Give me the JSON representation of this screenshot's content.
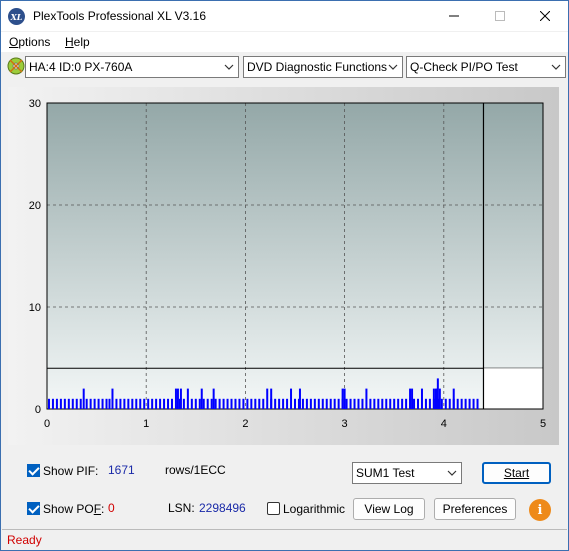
{
  "window": {
    "title": "PlexTools Professional XL V3.16",
    "app_icon_text": "XL"
  },
  "menu": {
    "items": [
      {
        "label": "Options",
        "accel": "O",
        "rest": "ptions"
      },
      {
        "label": "Help",
        "accel": "H",
        "rest": "elp"
      }
    ]
  },
  "toolbar": {
    "drive": "HA:4 ID:0  PX-760A",
    "function": "DVD Diagnostic Functions",
    "test": "Q-Check PI/PO Test"
  },
  "chart_data": {
    "type": "bar",
    "x_ticks": [
      "0",
      "1",
      "2",
      "3",
      "4",
      "5"
    ],
    "y_ticks": [
      "0",
      "10",
      "20",
      "30"
    ],
    "xlim": [
      0,
      5
    ],
    "ylim": [
      0,
      30
    ],
    "grid": true,
    "threshold": 4,
    "marker_x": 4.4,
    "series": [
      {
        "color": "#0000ff",
        "x": [
          0.02,
          0.06,
          0.1,
          0.14,
          0.18,
          0.22,
          0.26,
          0.3,
          0.34,
          0.37,
          0.4,
          0.44,
          0.48,
          0.52,
          0.56,
          0.6,
          0.63,
          0.66,
          0.7,
          0.74,
          0.78,
          0.82,
          0.86,
          0.9,
          0.94,
          0.98,
          1.02,
          1.06,
          1.1,
          1.14,
          1.18,
          1.22,
          1.26,
          1.3,
          1.34,
          1.38,
          1.42,
          1.46,
          1.5,
          1.54,
          1.58,
          1.62,
          1.66,
          1.7,
          1.74,
          1.78,
          1.82,
          1.86,
          1.9,
          1.94,
          1.98,
          2.02,
          2.06,
          2.1,
          2.14,
          2.18,
          2.22,
          2.26,
          2.3,
          2.34,
          2.38,
          2.42,
          2.46,
          2.5,
          2.54,
          2.58,
          2.62,
          2.66,
          2.7,
          2.74,
          2.78,
          2.82,
          2.86,
          2.9,
          2.94,
          2.98,
          3.02,
          3.06,
          3.1,
          3.14,
          3.18,
          3.22,
          3.26,
          3.3,
          3.34,
          3.38,
          3.42,
          3.46,
          3.5,
          3.54,
          3.58,
          3.62,
          3.66,
          3.7,
          3.74,
          3.78,
          3.82,
          3.86,
          3.9,
          3.93,
          3.95,
          3.98,
          4.02,
          4.06,
          4.1,
          4.14,
          4.18,
          4.22,
          4.26,
          4.3,
          4.34
        ],
        "values": [
          1,
          1,
          1,
          1,
          1,
          1,
          1,
          1,
          1,
          2,
          1,
          1,
          1,
          1,
          1,
          1,
          1,
          2,
          1,
          1,
          1,
          1,
          1,
          1,
          1,
          1,
          1,
          1,
          1,
          1,
          1,
          1,
          1,
          2,
          1,
          1,
          2,
          1,
          1,
          1,
          1,
          1,
          1,
          1,
          1,
          1,
          1,
          1,
          1,
          1,
          1,
          1,
          1,
          1,
          1,
          1,
          2,
          1,
          1,
          1,
          1,
          1,
          2,
          1,
          1,
          1,
          1,
          1,
          1,
          1,
          1,
          1,
          1,
          1,
          1,
          1,
          1,
          1,
          1,
          1,
          1,
          2,
          1,
          1,
          1,
          1,
          1,
          1,
          1,
          1,
          1,
          1,
          1,
          1,
          1,
          2,
          1,
          1,
          1,
          2,
          1,
          1,
          1,
          1,
          1,
          1,
          1,
          1,
          1,
          1,
          1
        ]
      },
      {
        "color": "#0000ff",
        "x": [
          1.32,
          1.35,
          1.56,
          1.68,
          2.26,
          2.55,
          2.98,
          3.0,
          3.66,
          3.68,
          3.9,
          3.92,
          3.94,
          3.96,
          4.1
        ],
        "values": [
          2,
          2,
          2,
          2,
          2,
          2,
          2,
          2,
          2,
          2,
          2,
          2,
          3,
          2,
          2
        ]
      }
    ]
  },
  "controls": {
    "show_pif_label": "Show PIF:",
    "pif_value": "1671",
    "pif_unit": "rows/1ECC",
    "show_pof_label_pre": "Show PO",
    "show_pof_label_accel": "F",
    "show_pof_label_post": ":",
    "pof_value": "0",
    "lsn_label": "LSN:",
    "lsn_value": "2298496",
    "logarithmic_label": "Logarithmic",
    "sum_select": "SUM1 Test",
    "start_label": "Start",
    "view_log_label": "View Log",
    "preferences_label": "Preferences",
    "info_icon_text": "i"
  },
  "status": {
    "text": "Ready"
  }
}
